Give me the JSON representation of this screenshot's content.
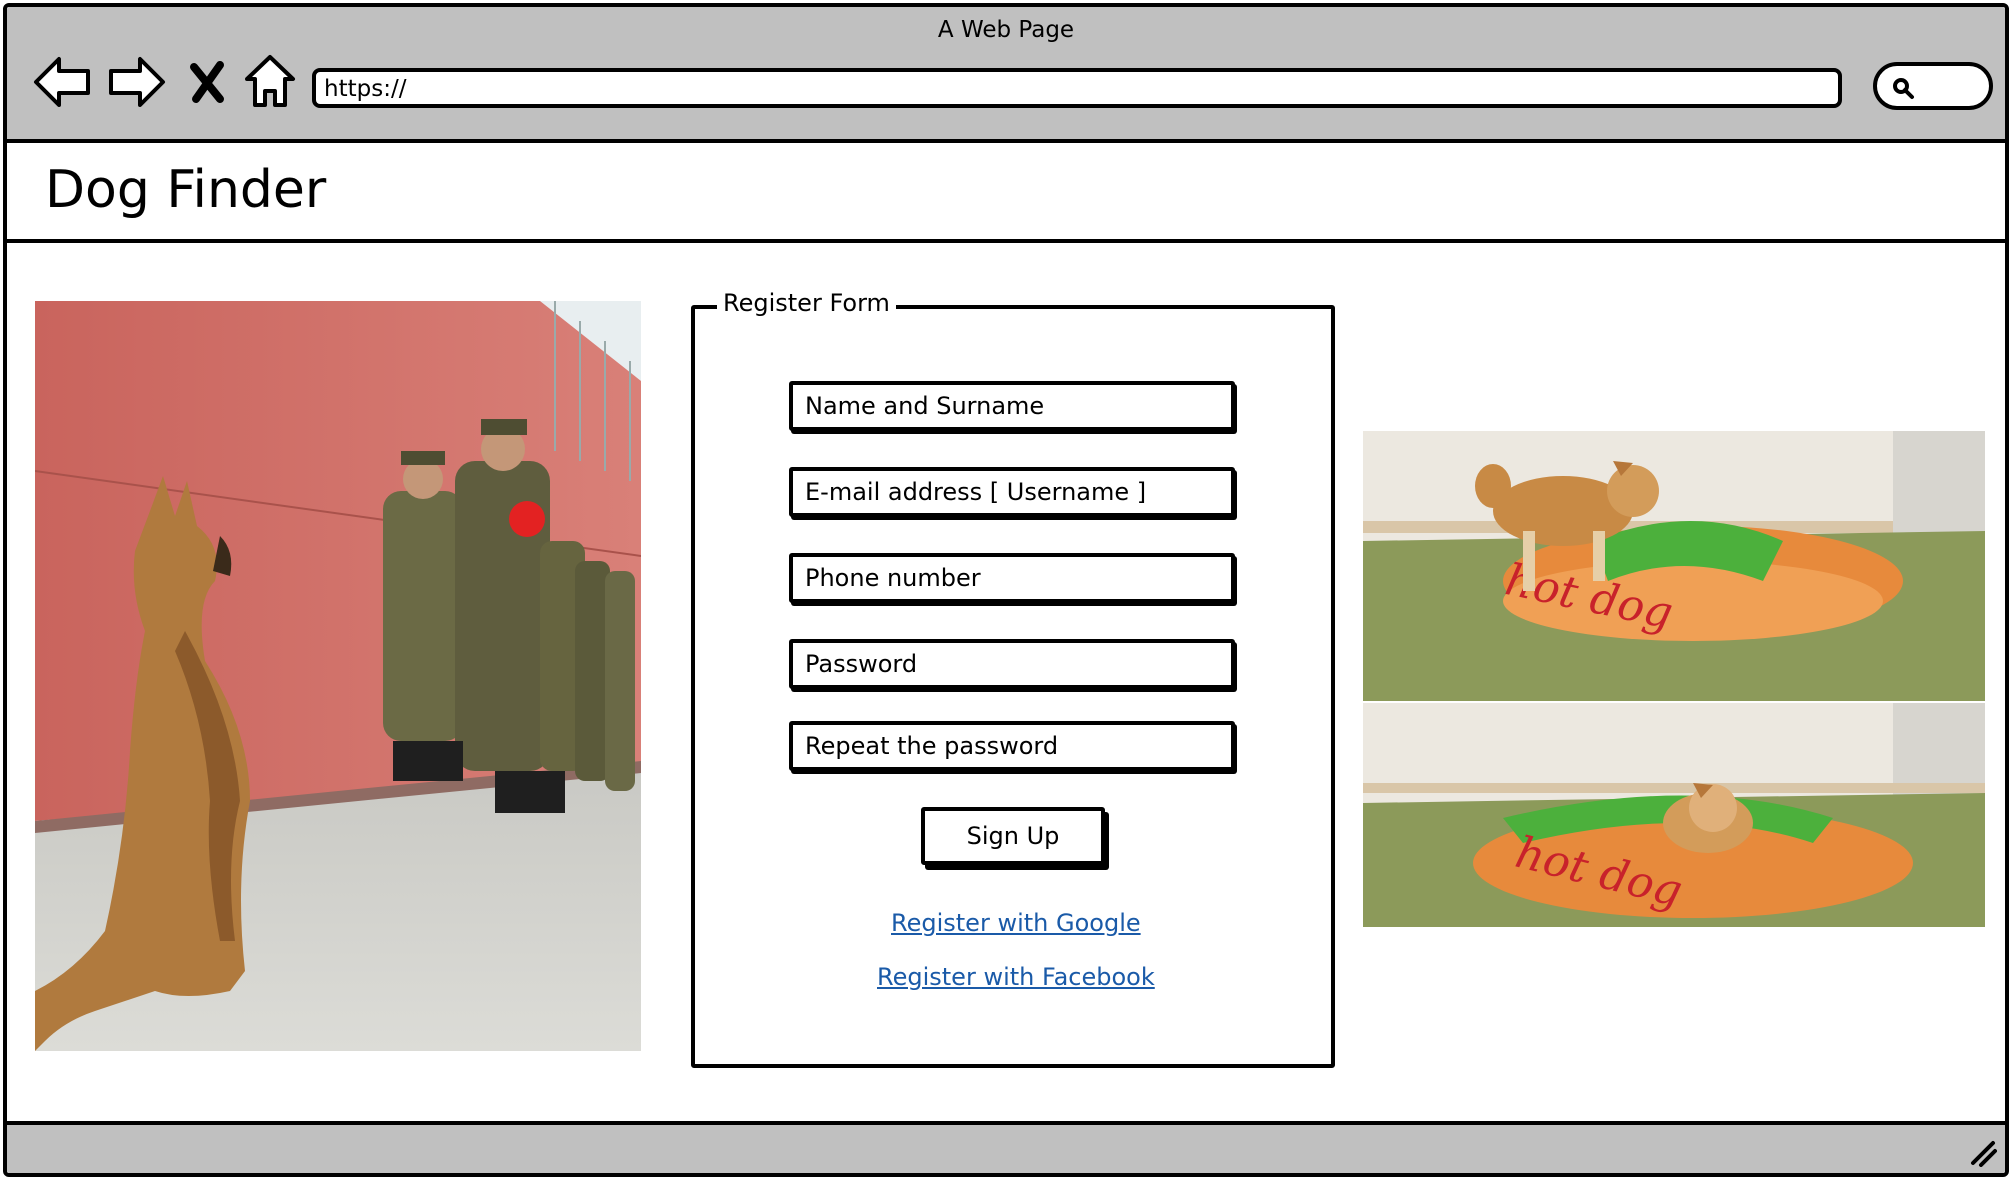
{
  "window": {
    "title": "A Web Page"
  },
  "browser": {
    "url_value": "https://",
    "icons": [
      "back-arrow-icon",
      "forward-arrow-icon",
      "close-x-icon",
      "home-icon",
      "search-icon"
    ]
  },
  "app": {
    "title": "Dog Finder"
  },
  "form": {
    "legend": "Register Form",
    "fields": {
      "name": "Name and Surname",
      "email": "E-mail address [ Username ]",
      "phone": "Phone number",
      "password": "Password",
      "repeat": "Repeat the password"
    },
    "signup_label": "Sign Up",
    "link_google": "Register with Google",
    "link_facebook": "Register with Facebook"
  },
  "images": {
    "left": "dog-saluting-soldiers-photo",
    "right_top": "shiba-on-hotdog-bed-photo",
    "right_bottom": "shiba-in-hotdog-bed-photo",
    "bed_text": "hot dog"
  },
  "colors": {
    "chrome": "#c0c0c0",
    "link": "#1a5aa8"
  }
}
